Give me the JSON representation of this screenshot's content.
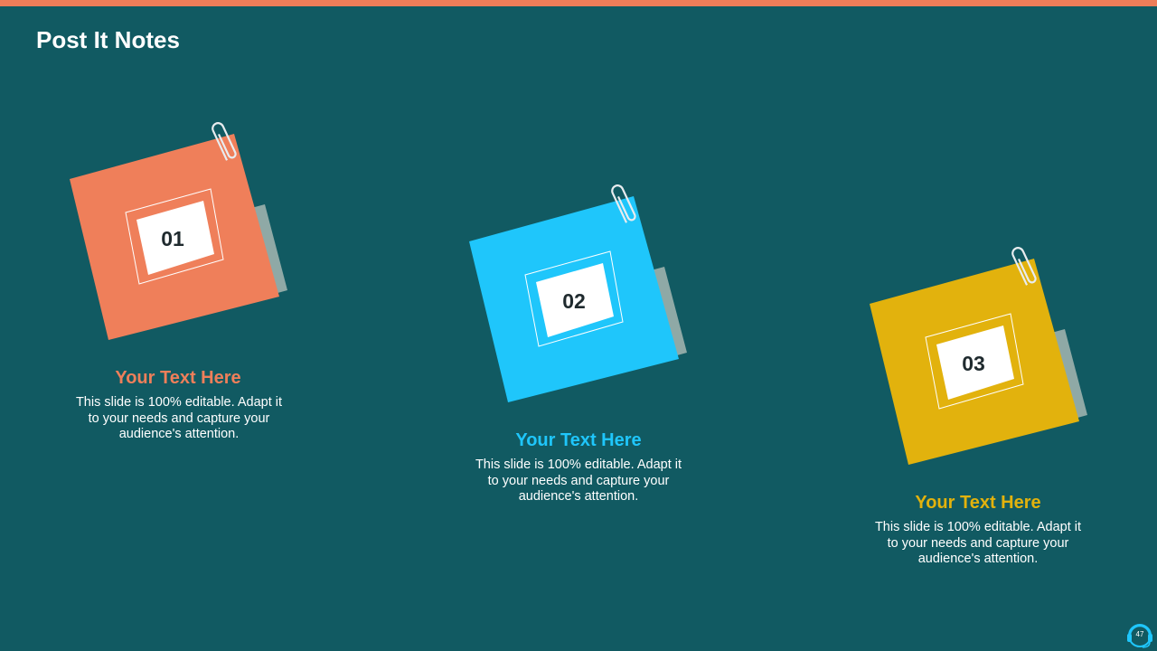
{
  "slide": {
    "title": "Post It Notes",
    "page_number": "47"
  },
  "colors": {
    "background": "#115a62",
    "top_bar": "#ee7d59",
    "shadow": "#8fa9a6"
  },
  "notes": [
    {
      "number": "01",
      "heading": "Your Text Here",
      "body": "This slide is 100% editable. Adapt it to your needs and capture your audience's attention.",
      "color": "#ef7f5a"
    },
    {
      "number": "02",
      "heading": "Your Text Here",
      "body": "This slide is 100% editable. Adapt it to your needs and capture your audience's attention.",
      "color": "#1fc6fb"
    },
    {
      "number": "03",
      "heading": "Your Text Here",
      "body": "This slide is 100% editable. Adapt it to your needs and capture your audience's attention.",
      "color": "#e2b20d"
    }
  ],
  "icons": {
    "clip": "paperclip-icon",
    "support": "headset-icon"
  }
}
